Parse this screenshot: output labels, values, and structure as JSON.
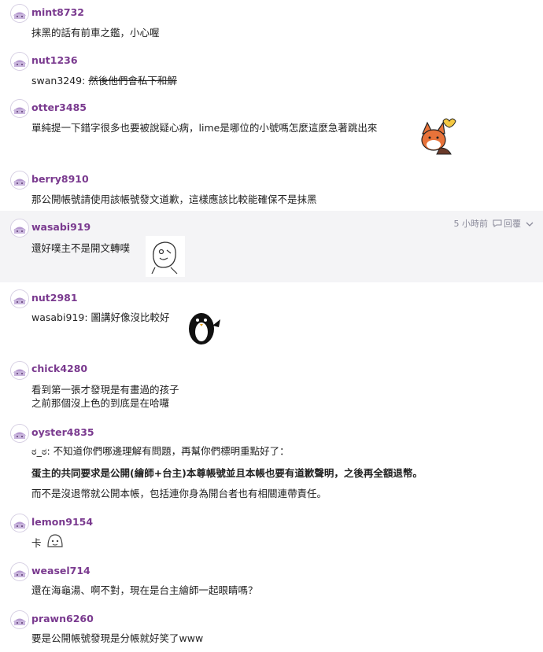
{
  "comments": [
    {
      "user": "mint8732",
      "lines": [
        "抹黑的話有前車之鑑，小心喔"
      ]
    },
    {
      "user": "nut1236",
      "prefix": "swan3249: ",
      "struck": "然後他們會私下和解"
    },
    {
      "user": "otter3485",
      "lines": [
        "單純提一下錯字很多也要被說疑心病，lime是哪位的小號嗎怎麼這麼急著跳出來"
      ],
      "sticker": "fox-sticker"
    },
    {
      "user": "berry8910",
      "lines": [
        "那公開帳號請使用該帳號發文道歉，這樣應該比較能確保不是抹黑"
      ]
    },
    {
      "user": "wasabi919",
      "lines": [
        "還好噗主不是開文轉噗"
      ],
      "sticker": "doodle-sticker",
      "time": "5 小時前",
      "reply": "回覆"
    },
    {
      "user": "nut2981",
      "lines": [
        "wasabi919: 圖講好像沒比較好"
      ],
      "sticker": "penguin-sticker"
    },
    {
      "user": "chick4280",
      "lines": [
        "看到第一張才發現是有畫過的孩子",
        "之前那個沒上色的到底是在哈囉"
      ]
    },
    {
      "user": "oyster4835",
      "lines": [
        "ಠ_ಠ: 不知道你們哪邊理解有問題，再幫你們標明重點好了："
      ],
      "bold_lines": [
        "蛋主的共同要求是公開(繪師+台主)本尊帳號並且本帳也要有道歉聲明，之後再全額退幣。"
      ],
      "extra_lines": [
        "而不是沒退幣就公開本帳，包括連你身為開台者也有相關連帶責任。"
      ]
    },
    {
      "user": "lemon9154",
      "lines": [
        "卡"
      ],
      "sticker": "small-face-sticker"
    },
    {
      "user": "weasel714",
      "lines": [
        "還在海龜湯、啊不對，現在是台主繪師一起眼睛嗎？"
      ]
    },
    {
      "user": "prawn6260",
      "lines": [
        "要是公開帳號發現是分帳就好笑了www"
      ]
    }
  ]
}
